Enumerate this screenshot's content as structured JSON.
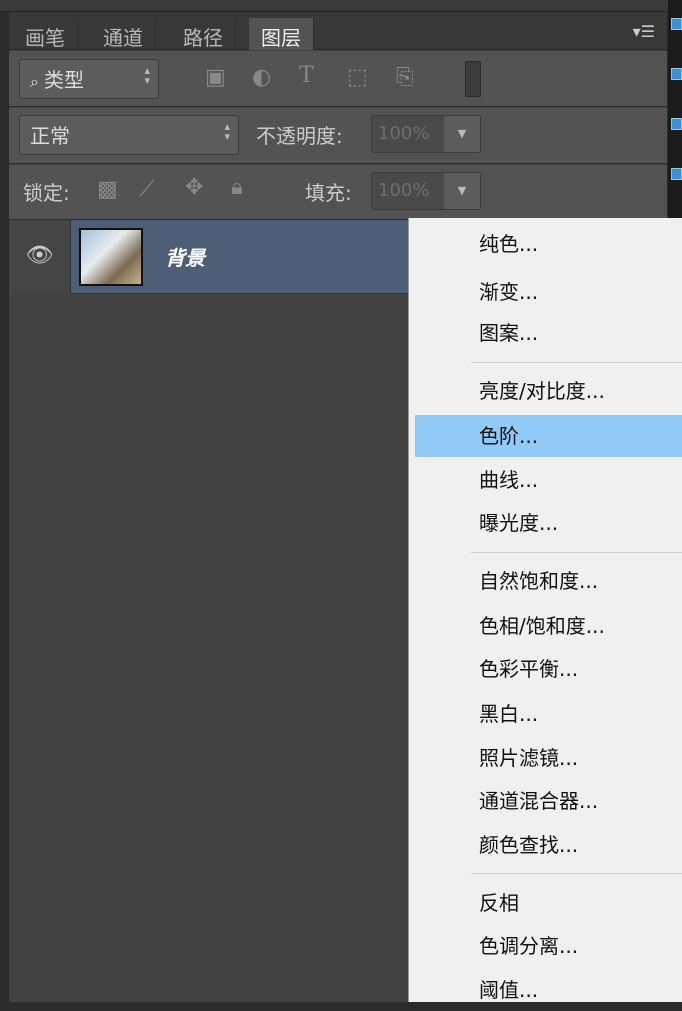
{
  "tabs": [
    "画笔",
    "通道",
    "路径",
    "图层"
  ],
  "active_tab": "图层",
  "filter": {
    "label": "类型",
    "icons": [
      "image-filter-icon",
      "adjustment-filter-icon",
      "type-filter-icon",
      "shape-filter-icon",
      "smart-object-filter-icon"
    ]
  },
  "blend": {
    "mode": "正常",
    "opacity_label": "不透明度:",
    "opacity": "100%"
  },
  "lock": {
    "label": "锁定:",
    "fill_label": "填充:",
    "fill": "100%"
  },
  "layer": {
    "name": "背景"
  },
  "menu": {
    "groups": [
      [
        "纯色...",
        "渐变...",
        "图案..."
      ],
      [
        "亮度/对比度...",
        "色阶...",
        "曲线...",
        "曝光度..."
      ],
      [
        "自然饱和度...",
        "色相/饱和度...",
        "色彩平衡...",
        "黑白...",
        "照片滤镜...",
        "通道混合器...",
        "颜色查找..."
      ],
      [
        "反相",
        "色调分离...",
        "阈值..."
      ]
    ],
    "highlighted": "色阶..."
  },
  "colors": {
    "highlight": "#91c9f7",
    "layer_selected": "#4e5e77"
  }
}
